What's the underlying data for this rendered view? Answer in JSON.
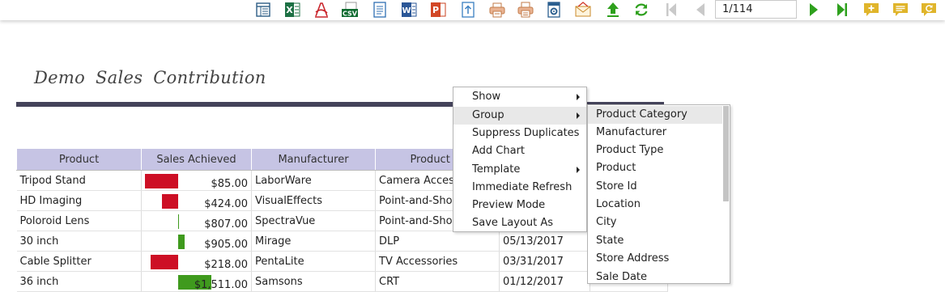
{
  "toolbar": {
    "icons": [
      "table-view-icon",
      "excel-icon",
      "pdf-icon",
      "csv-icon",
      "text-icon",
      "word-icon",
      "powerpoint-icon",
      "export-icon",
      "print-icon",
      "print-setup-icon",
      "settings-icon",
      "email-icon",
      "upload-icon",
      "refresh-icon",
      "first-page-icon",
      "previous-page-icon",
      "next-page-icon",
      "last-page-icon",
      "add-comment-icon",
      "comments-icon",
      "comment-refresh-icon"
    ],
    "csv_label": "CSV",
    "page_value": "1/114",
    "accent": "#3aa8c9",
    "green": "#2ea01d",
    "comment_yellow": "#e0b52b"
  },
  "report": {
    "title": "Demo  Sales  Contribution",
    "columns": [
      "Product",
      "Sales Achieved",
      "Manufacturer",
      "Product Ty",
      "",
      ""
    ],
    "rows": [
      {
        "product": "Tripod Stand",
        "sales": "$85.00",
        "manufacturer": "LaborWare",
        "type": "Camera Accesso",
        "date": "",
        "bar": -0.3
      },
      {
        "product": "HD Imaging",
        "sales": "$424.00",
        "manufacturer": "VisualEffects",
        "type": "Point-and-Shoot",
        "date": "",
        "bar": -0.15
      },
      {
        "product": "Poloroid Lens",
        "sales": "$807.00",
        "manufacturer": "SpectraVue",
        "type": "Point-and-Shoot",
        "date": "",
        "bar": 0.01
      },
      {
        "product": "30 inch",
        "sales": "$905.00",
        "manufacturer": "Mirage",
        "type": "DLP",
        "date": "05/13/2017",
        "bar": 0.06
      },
      {
        "product": "Cable Splitter",
        "sales": "$218.00",
        "manufacturer": "PentaLite",
        "type": "TV Accessories",
        "date": "03/31/2017",
        "bar": -0.25
      },
      {
        "product": "36 inch",
        "sales": "$1,511.00",
        "manufacturer": "Samsons",
        "type": "CRT",
        "date": "01/12/2017",
        "bar": 0.3
      }
    ],
    "colors": {
      "header": "#c6c4e4",
      "negative": "#cd0f25",
      "positive": "#3f9a1d",
      "rule": "#44435a"
    }
  },
  "context_menu": {
    "items": [
      {
        "label": "Show",
        "submenu": true
      },
      {
        "label": "Group",
        "submenu": true,
        "highlighted": true
      },
      {
        "label": "Suppress Duplicates",
        "submenu": false
      },
      {
        "label": "Add Chart",
        "submenu": false
      },
      {
        "label": "Template",
        "submenu": true
      },
      {
        "label": "Immediate Refresh",
        "submenu": false
      },
      {
        "label": "Preview Mode",
        "submenu": false
      },
      {
        "label": "Save Layout As",
        "submenu": false
      }
    ]
  },
  "group_submenu": {
    "items": [
      "Product Category",
      "Manufacturer",
      "Product Type",
      "Product",
      "Store Id",
      "Location",
      "City",
      "State",
      "Store Address",
      "Sale Date"
    ],
    "highlighted_index": 0
  }
}
